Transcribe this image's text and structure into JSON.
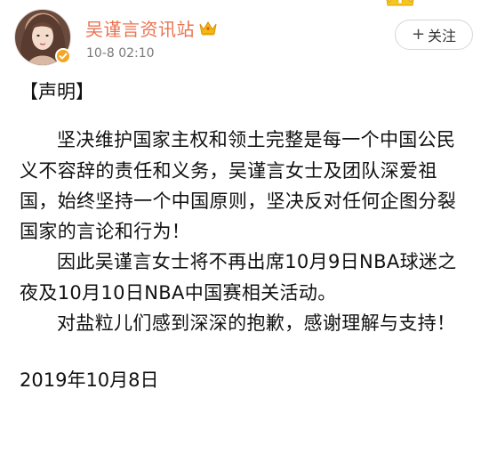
{
  "post": {
    "author_name": "吴谨言资讯站",
    "timestamp": "10-8 02:10",
    "follow_label": "关注",
    "follow_plus": "+"
  },
  "content": {
    "title": "【声明】",
    "paragraphs": [
      "坚决维护国家主权和领土完整是每一个中国公民义不容辞的责任和义务，吴谨言女士及团队深爱祖国，始终坚持一个中国原则，坚决反对任何企图分裂国家的言论和行为！",
      "因此吴谨言女士将不再出席10月9日NBA球迷之夜及10月10日NBA中国赛相关活动。",
      "对盐粒儿们感到深深的抱歉，感谢理解与支持！"
    ],
    "date": "2019年10月8日"
  },
  "icons": {
    "avatar": "profile-photo",
    "verified": "verified-badge-icon",
    "crown": "crown-icon",
    "decor": "crown-decor-icon"
  },
  "colors": {
    "name": "#eb7350",
    "timestamp": "#7a7a7a",
    "verified": "#f5a623",
    "crown": "#f2b90f",
    "text": "#111111"
  }
}
